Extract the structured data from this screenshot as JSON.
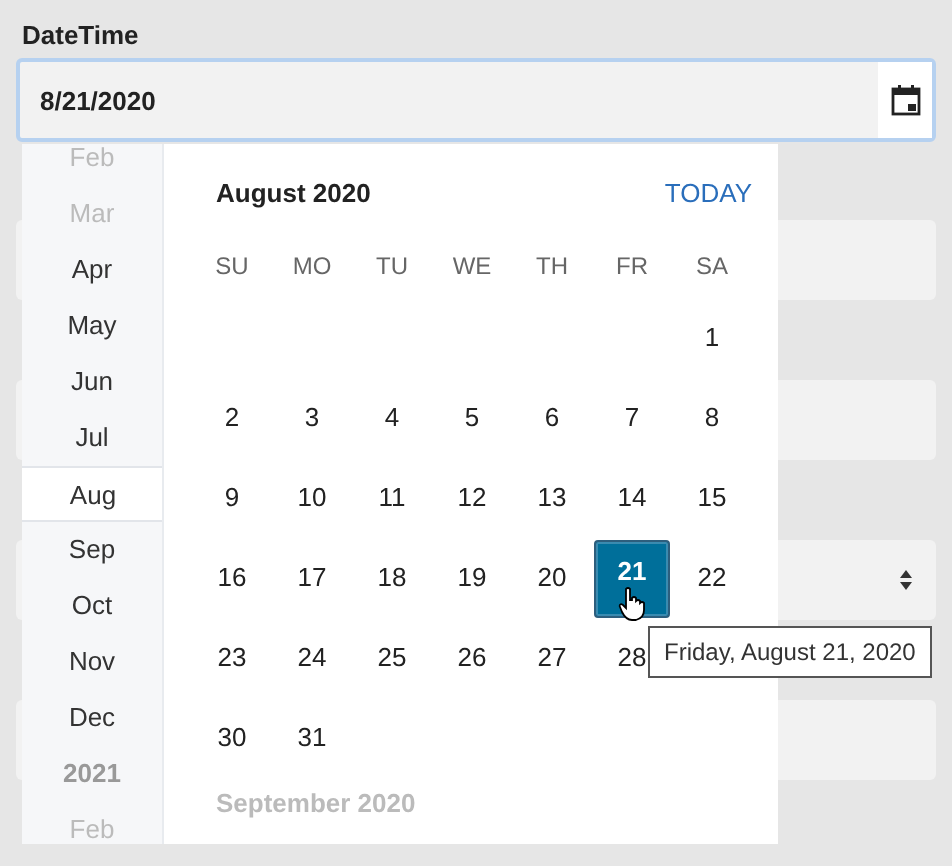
{
  "field_label": "DateTime",
  "date_input": {
    "value": "8/21/2020"
  },
  "picker": {
    "months": [
      {
        "label": "Feb",
        "kind": "month",
        "dimmed": true,
        "selected": false
      },
      {
        "label": "Mar",
        "kind": "month",
        "dimmed": true,
        "selected": false
      },
      {
        "label": "Apr",
        "kind": "month",
        "dimmed": false,
        "selected": false
      },
      {
        "label": "May",
        "kind": "month",
        "dimmed": false,
        "selected": false
      },
      {
        "label": "Jun",
        "kind": "month",
        "dimmed": false,
        "selected": false
      },
      {
        "label": "Jul",
        "kind": "month",
        "dimmed": false,
        "selected": false
      },
      {
        "label": "Aug",
        "kind": "month",
        "dimmed": false,
        "selected": true
      },
      {
        "label": "Sep",
        "kind": "month",
        "dimmed": false,
        "selected": false
      },
      {
        "label": "Oct",
        "kind": "month",
        "dimmed": false,
        "selected": false
      },
      {
        "label": "Nov",
        "kind": "month",
        "dimmed": false,
        "selected": false
      },
      {
        "label": "Dec",
        "kind": "month",
        "dimmed": false,
        "selected": false
      },
      {
        "label": "2021",
        "kind": "year",
        "dimmed": false,
        "selected": false
      },
      {
        "label": "Feb",
        "kind": "month",
        "dimmed": true,
        "selected": false
      }
    ],
    "month_title": "August 2020",
    "today_button": "TODAY",
    "weekdays": [
      "SU",
      "MO",
      "TU",
      "WE",
      "TH",
      "FR",
      "SA"
    ],
    "weeks": [
      [
        {
          "label": "1",
          "selected": false
        }
      ],
      [
        {
          "label": "2",
          "selected": false
        },
        {
          "label": "3",
          "selected": false
        },
        {
          "label": "4",
          "selected": false
        },
        {
          "label": "5",
          "selected": false
        },
        {
          "label": "6",
          "selected": false
        },
        {
          "label": "7",
          "selected": false
        },
        {
          "label": "8",
          "selected": false
        }
      ],
      [
        {
          "label": "9",
          "selected": false
        },
        {
          "label": "10",
          "selected": false
        },
        {
          "label": "11",
          "selected": false
        },
        {
          "label": "12",
          "selected": false
        },
        {
          "label": "13",
          "selected": false
        },
        {
          "label": "14",
          "selected": false
        },
        {
          "label": "15",
          "selected": false
        }
      ],
      [
        {
          "label": "16",
          "selected": false
        },
        {
          "label": "17",
          "selected": false
        },
        {
          "label": "18",
          "selected": false
        },
        {
          "label": "19",
          "selected": false
        },
        {
          "label": "20",
          "selected": false
        },
        {
          "label": "21",
          "selected": true
        },
        {
          "label": "22",
          "selected": false
        }
      ],
      [
        {
          "label": "23",
          "selected": false
        },
        {
          "label": "24",
          "selected": false
        },
        {
          "label": "25",
          "selected": false
        },
        {
          "label": "26",
          "selected": false
        },
        {
          "label": "27",
          "selected": false
        },
        {
          "label": "28",
          "selected": false
        }
      ],
      [
        {
          "label": "30",
          "selected": false
        },
        {
          "label": "31",
          "selected": false
        }
      ]
    ],
    "next_month_title": "September 2020",
    "tooltip": "Friday, August 21, 2020"
  },
  "background_fields": [
    {
      "kind": "text"
    },
    {
      "kind": "text"
    },
    {
      "kind": "select"
    },
    {
      "kind": "text"
    }
  ]
}
